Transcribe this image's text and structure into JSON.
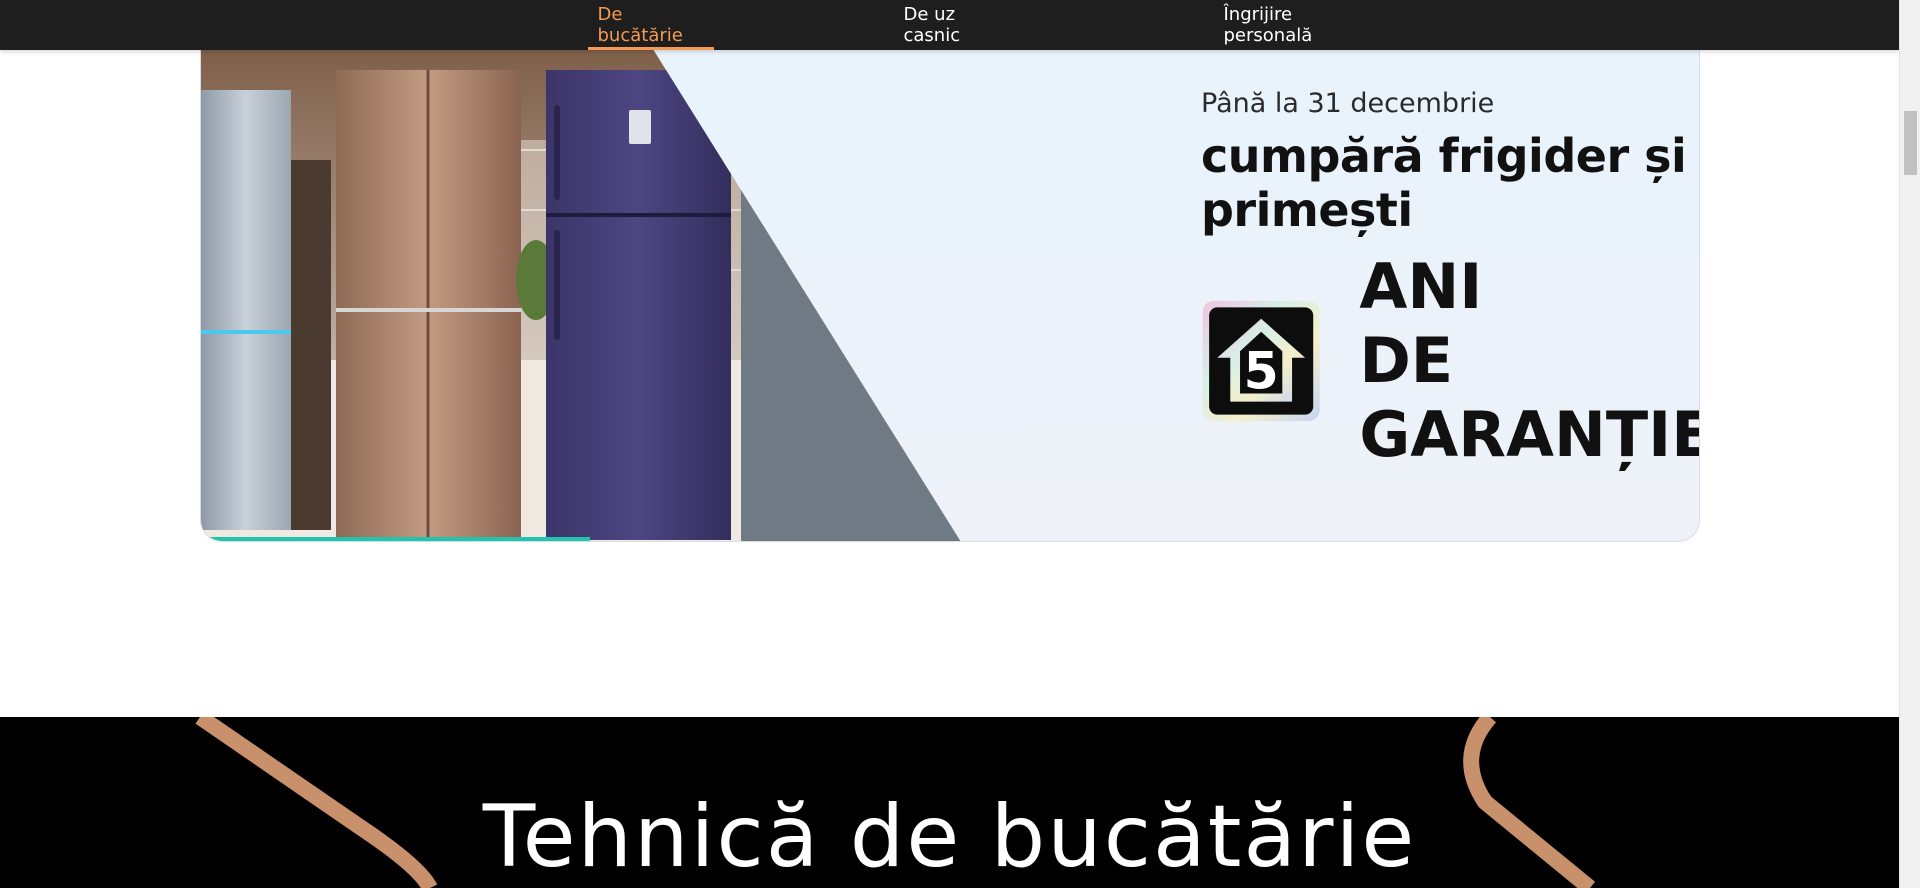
{
  "nav": {
    "tabs": [
      {
        "label": "De bucătărie",
        "active": true
      },
      {
        "label": "De uz casnic",
        "active": false
      },
      {
        "label": "Îngrijire personală",
        "active": false
      }
    ],
    "active_color": "#f59a54"
  },
  "banner": {
    "subtitle": "Până la 31 decembrie",
    "headline": "cumpără frigider și primești",
    "badge_number": "5",
    "warranty_line1": "ANI",
    "warranty_line2": "DE GARANȚIE",
    "progress_percent": 26,
    "progress_color": "#22c4b0"
  },
  "section": {
    "title": "Tehnică de bucătărie",
    "accent_color": "#c8906b"
  }
}
